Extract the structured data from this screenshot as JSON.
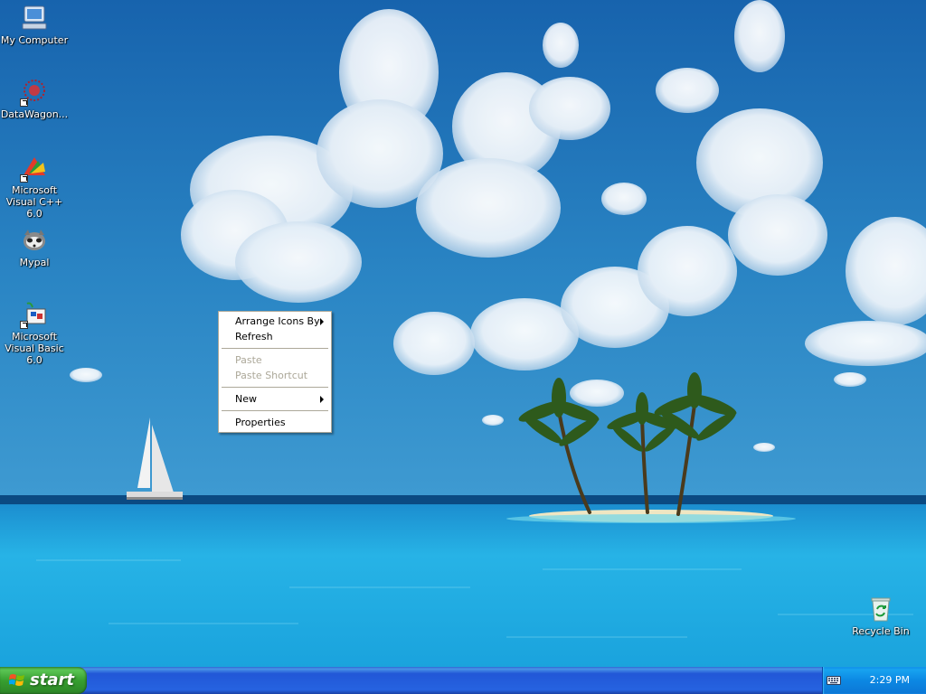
{
  "desktop": {
    "icons": [
      {
        "label": "My Computer",
        "icon": "my-computer-icon"
      },
      {
        "label": "DataWagon...",
        "icon": "datawagon-icon"
      },
      {
        "label": "Microsoft Visual C++ 6.0",
        "icon": "visual-cpp-icon"
      },
      {
        "label": "Mypal",
        "icon": "mypal-icon"
      },
      {
        "label": "Microsoft Visual Basic 6.0",
        "icon": "visual-basic-icon"
      },
      {
        "label": "Recycle Bin",
        "icon": "recycle-bin-icon"
      }
    ]
  },
  "context_menu": {
    "arrange_icons_by": "Arrange Icons By",
    "refresh": "Refresh",
    "paste": "Paste",
    "paste_shortcut": "Paste Shortcut",
    "new": "New",
    "properties": "Properties"
  },
  "taskbar": {
    "start_label": "start",
    "clock": "2:29 PM"
  },
  "colors": {
    "taskbar_blue": "#2157d7",
    "start_green": "#379f30",
    "tray_blue": "#0c88e3",
    "menu_disabled": "#aca899"
  }
}
